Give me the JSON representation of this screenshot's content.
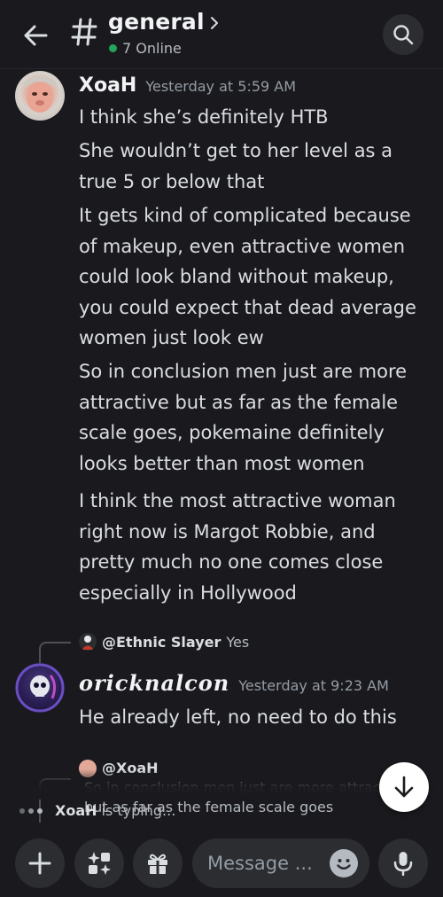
{
  "header": {
    "channel_name": "general",
    "online": "7 Online"
  },
  "messages": [
    {
      "author": "XoaH",
      "timestamp": "Yesterday at 5:59 AM",
      "lines": [
        "I think she’s definitely HTB",
        "She wouldn’t get to her level as a true 5 or below that",
        "It gets kind of complicated because of makeup, even attractive women could look bland without makeup, you could expect that dead average women just look ew",
        "So in conclusion men just are more attractive but as far as the female scale goes, pokemaine definitely looks better than most women",
        "I think the most attractive woman right now is Margot Robbie, and pretty much no one comes close especially in Hollywood"
      ]
    },
    {
      "reply_to": {
        "mention": "@Ethnic Slayer",
        "text": "Yes"
      },
      "author": "oricknalcon",
      "timestamp": "Yesterday at 9:23 AM",
      "lines": [
        "He already left, no need to do this"
      ]
    },
    {
      "reply_to": {
        "mention": "@XoaH",
        "text": "So in conclusion men just are more attractive but as far as the female scale goes"
      }
    }
  ],
  "typing": {
    "name": "XoaH",
    "text": "is typing..."
  },
  "composer": {
    "placeholder": "Message ..."
  },
  "icons": {
    "back": "arrow-left-icon",
    "channel": "hash-icon",
    "search": "search-icon",
    "jump": "arrow-down-icon",
    "add": "plus-icon",
    "apps": "sparkle-apps-icon",
    "gift": "gift-icon",
    "emoji": "emoji-icon",
    "mic": "microphone-icon"
  },
  "colors": {
    "online": "#23a55a",
    "background": "#1a1a1e",
    "surface": "#2b2d31"
  }
}
